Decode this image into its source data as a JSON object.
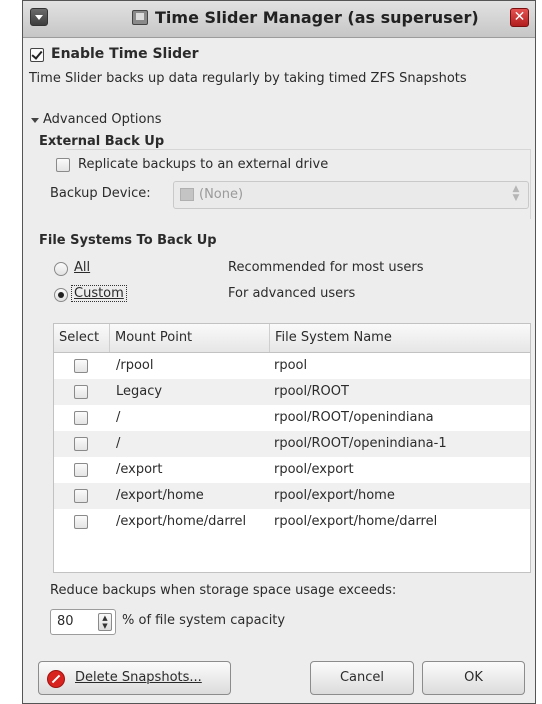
{
  "window": {
    "title": "Time Slider Manager (as superuser)",
    "close_glyph": "✕"
  },
  "enable": {
    "label": "Enable Time Slider",
    "checked": true,
    "description": "Time Slider backs up data regularly by taking timed ZFS Snapshots"
  },
  "advanced": {
    "label": "Advanced Options",
    "external_heading": "External Back Up",
    "replicate_label": "Replicate backups to an external drive",
    "replicate_checked": false,
    "device_label": "Backup Device:",
    "device_value": "(None)"
  },
  "filesystems": {
    "heading": "File Systems To Back Up",
    "options": [
      {
        "label": "All",
        "description": "Recommended for most users",
        "selected": false
      },
      {
        "label": "Custom",
        "description": "For advanced users",
        "selected": true
      }
    ],
    "columns": [
      "Select",
      "Mount Point",
      "File System Name"
    ],
    "rows": [
      {
        "checked": false,
        "mount": "/rpool",
        "fs": "rpool"
      },
      {
        "checked": false,
        "mount": "Legacy",
        "fs": "rpool/ROOT"
      },
      {
        "checked": false,
        "mount": "/",
        "fs": "rpool/ROOT/openindiana"
      },
      {
        "checked": false,
        "mount": "/",
        "fs": "rpool/ROOT/openindiana-1"
      },
      {
        "checked": false,
        "mount": "/export",
        "fs": "rpool/export"
      },
      {
        "checked": false,
        "mount": "/export/home",
        "fs": "rpool/export/home"
      },
      {
        "checked": false,
        "mount": "/export/home/darrel",
        "fs": "rpool/export/home/darrel"
      }
    ]
  },
  "storage": {
    "label": "Reduce backups when storage space usage exceeds:",
    "value": "80",
    "suffix": "% of file system capacity"
  },
  "buttons": {
    "delete": "Delete Snapshots...",
    "cancel": "Cancel",
    "ok": "OK"
  },
  "icons": {
    "menu": "window-menu-icon",
    "title": "time-slider-app-icon",
    "close": "close-icon",
    "delete": "no-entry-icon",
    "device": "drive-icon"
  },
  "colors": {
    "close_button": "#c62828",
    "delete_icon": "#d8231f"
  }
}
